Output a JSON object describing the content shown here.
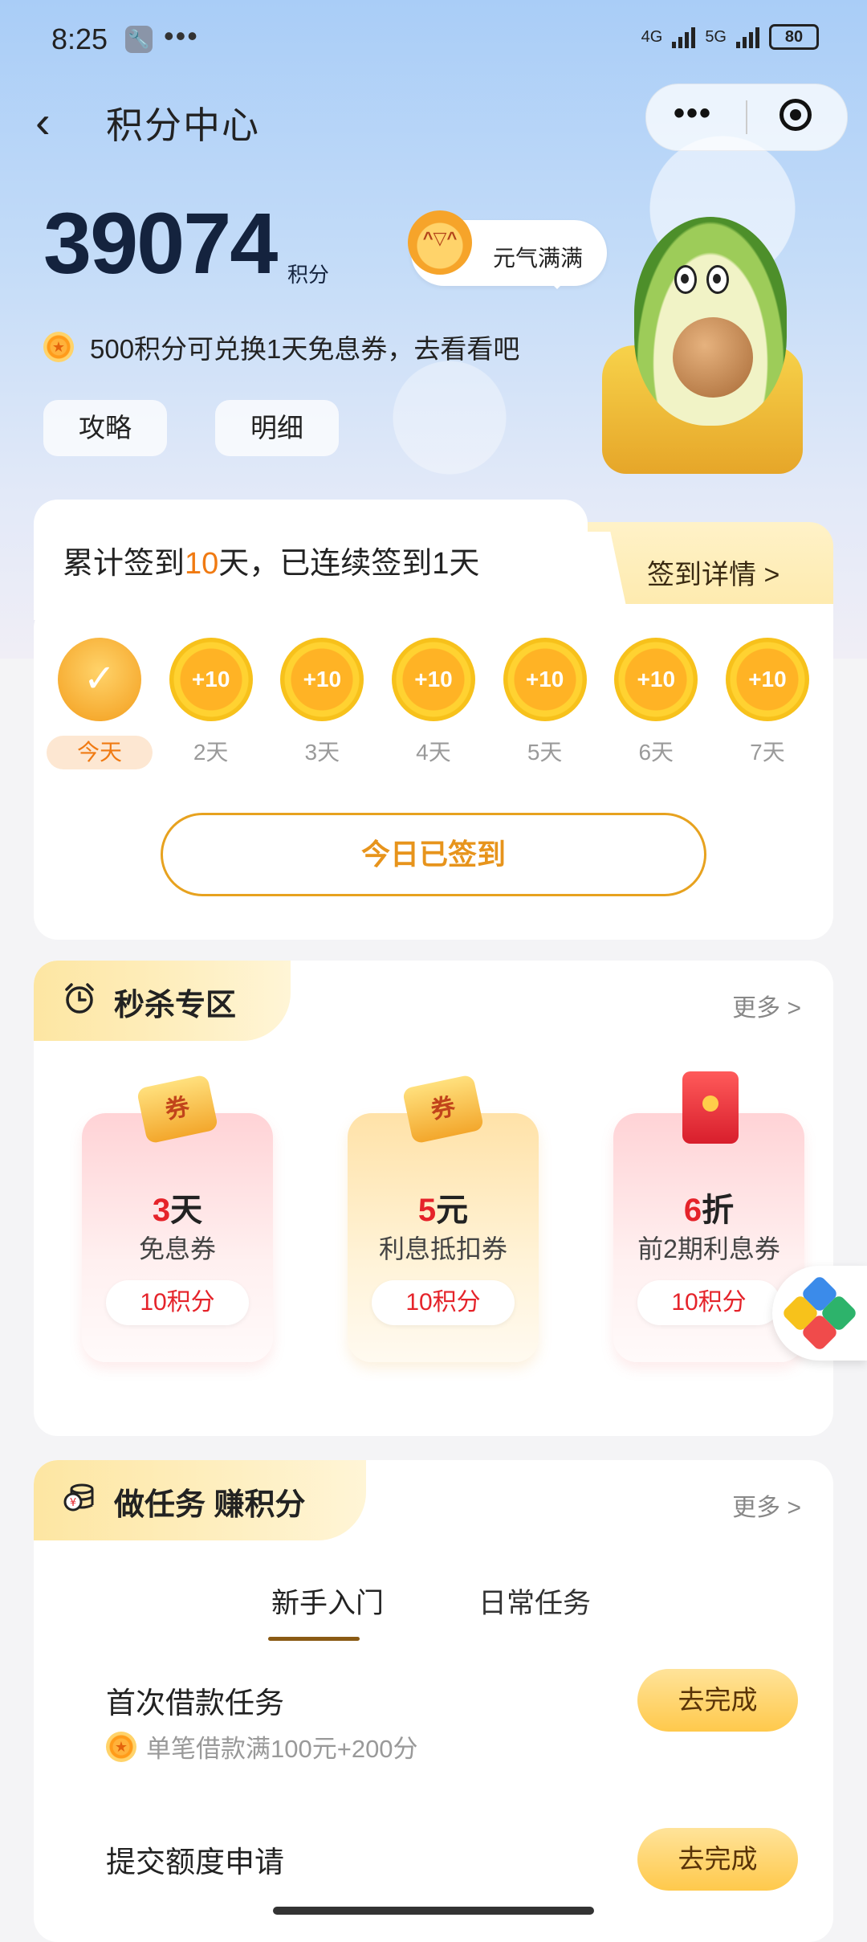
{
  "status": {
    "time": "8:25",
    "dots": "•••",
    "net1": "4G",
    "net2": "5G",
    "battery": "80"
  },
  "nav": {
    "back": "‹",
    "title": "积分中心",
    "capsule_more": "•••"
  },
  "points": {
    "value": "39074",
    "unit": "积分",
    "mood": "元气满满",
    "tip": "500积分可兑换1天免息券，去看看吧"
  },
  "actions": {
    "guide": "攻略",
    "detail": "明细"
  },
  "signin": {
    "summary_pre": "累计签到",
    "summary_days": "10",
    "summary_post": "天，已连续签到1天",
    "detail_link": "签到详情 >",
    "days": [
      {
        "coin": "✓",
        "label": "今天"
      },
      {
        "coin": "+10",
        "label": "2天"
      },
      {
        "coin": "+10",
        "label": "3天"
      },
      {
        "coin": "+10",
        "label": "4天"
      },
      {
        "coin": "+10",
        "label": "5天"
      },
      {
        "coin": "+10",
        "label": "6天"
      },
      {
        "coin": "+10",
        "label": "7天"
      }
    ],
    "button": "今日已签到"
  },
  "flash": {
    "title": "秒杀专区",
    "more": "更多 >",
    "offers": [
      {
        "num": "3",
        "unit": "天",
        "sub": "免息券",
        "price": "10积分",
        "badge": "券"
      },
      {
        "num": "5",
        "unit": "元",
        "sub": "利息抵扣券",
        "price": "10积分",
        "badge": "券"
      },
      {
        "num": "6",
        "unit": "折",
        "sub": "前2期利息券",
        "price": "10积分",
        "badge": ""
      }
    ]
  },
  "tasks": {
    "title": "做任务 赚积分",
    "more": "更多 >",
    "tabs": [
      "新手入门",
      "日常任务"
    ],
    "items": [
      {
        "name": "首次借款任务",
        "reward": "单笔借款满100元+200分",
        "button": "去完成"
      },
      {
        "name": "提交额度申请",
        "reward": "",
        "button": "去完成"
      }
    ]
  }
}
